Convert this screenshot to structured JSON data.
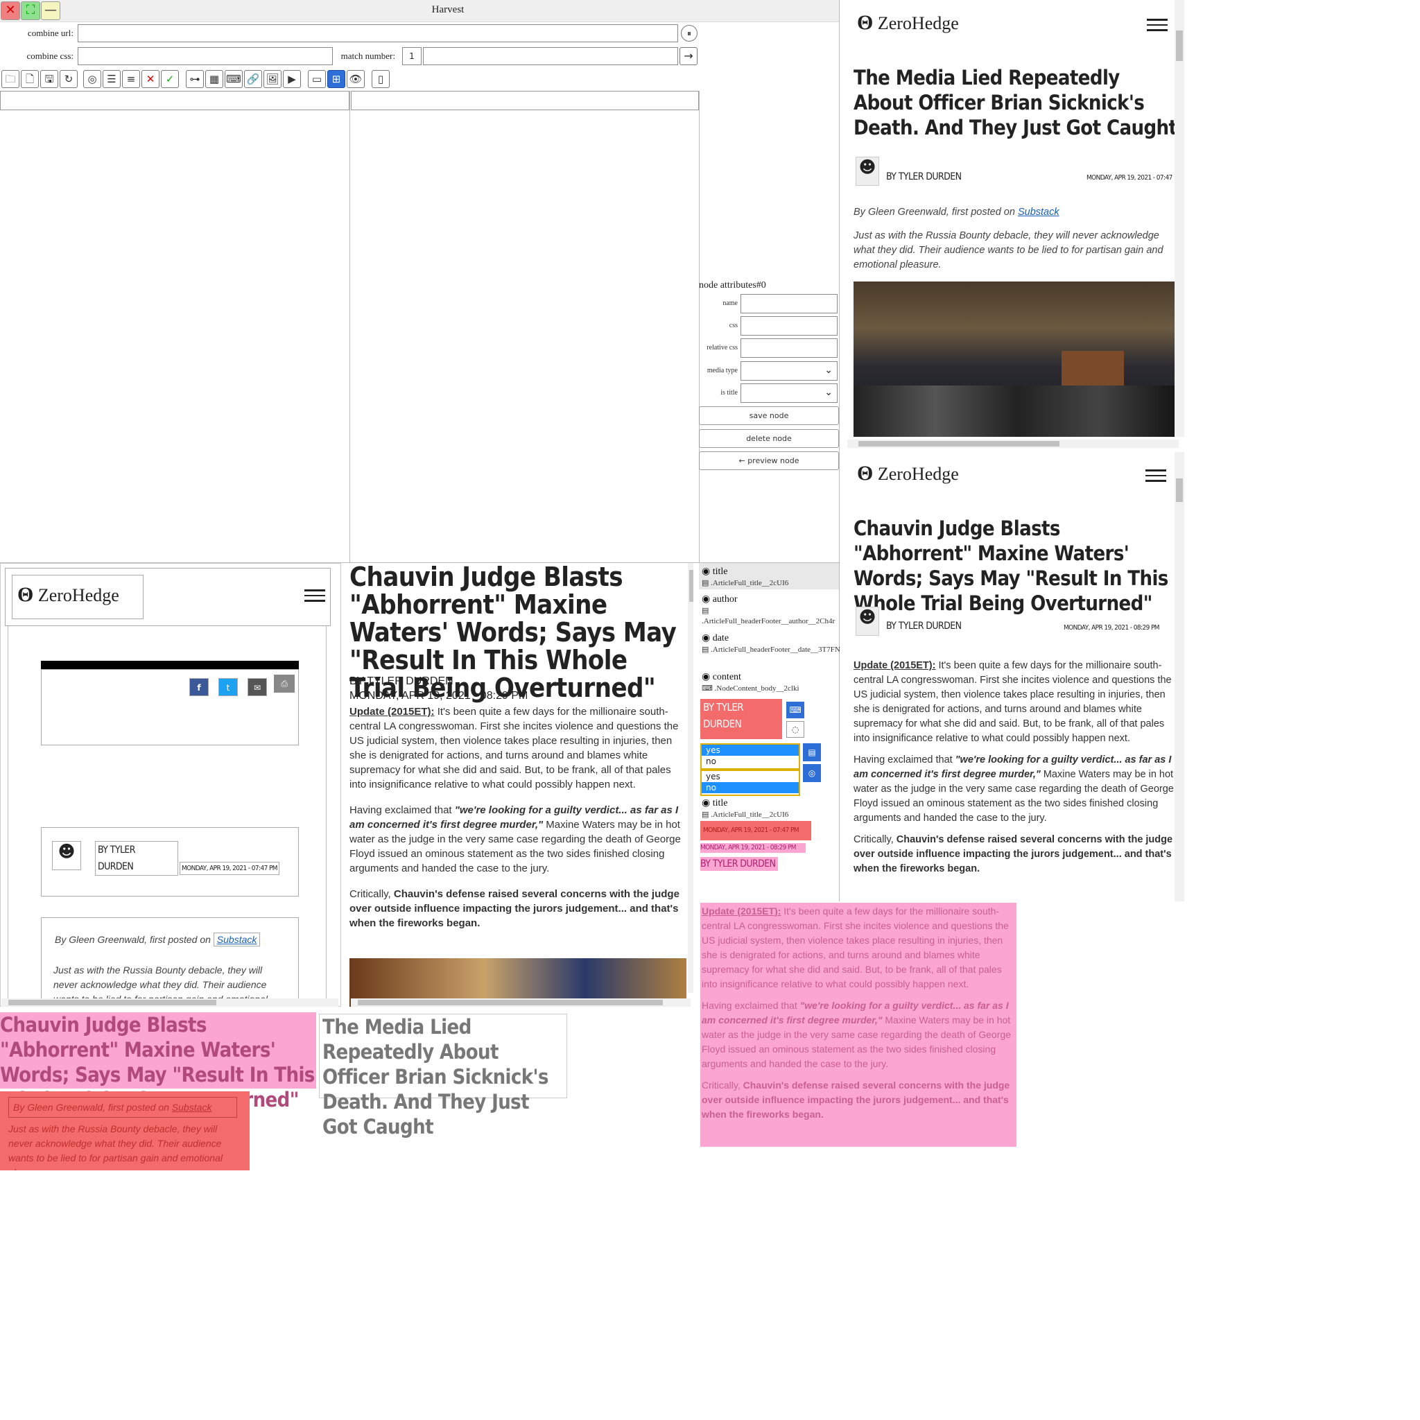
{
  "app": {
    "title": "Harvest"
  },
  "form": {
    "combine_url_label": "combine url:",
    "combine_css_label": "combine css:",
    "match_number_label": "match number:",
    "match_number_value": "1"
  },
  "attributes": {
    "heading": "node attributes#0",
    "name_label": "name",
    "css_label": "css",
    "relative_css_label": "relative css",
    "media_type_label": "media type",
    "is_title_label": "is title",
    "save_label": "save node",
    "delete_label": "delete node",
    "preview_label": "← preview node"
  },
  "nodes": [
    {
      "label": "title",
      "css": ".ArticleFull_title__2cUI6"
    },
    {
      "label": "author",
      "css": ".ArticleFull_headerFooter__author__2Ch4r"
    },
    {
      "label": "date",
      "css": ".ArticleFull_headerFooter__date__3T7FN"
    },
    {
      "label": "content",
      "css": ".NodeContent_body__2clki"
    }
  ],
  "node_tail": {
    "label": "title",
    "css": ".ArticleFull_title__2cUI6"
  },
  "options": {
    "yes": "yes",
    "no": "no"
  },
  "site": {
    "logo": "ZeroHedge"
  },
  "article1": {
    "title": "The Media Lied Repeatedly About Officer Brian Sicknick's Death. And They Just Got Caught",
    "author": "BY TYLER DURDEN",
    "author_short1": "BY TYLER",
    "author_short2": "DURDEN",
    "date": "MONDAY, APR 19, 2021 - 07:47",
    "date_pm": "MONDAY, APR 19, 2021 - 07:47 PM",
    "byline_pre": "By Gleen Greenwald, first posted on ",
    "byline_link": "Substack",
    "lead": "Just as with the Russia Bounty debacle, they will never acknowledge what they did. Their audience wants to be lied to for partisan gain and emotional pleasure."
  },
  "article2": {
    "title": "Chauvin Judge Blasts \"Abhorrent\" Maxine Waters' Words; Says May \"Result In This Whole Trial Being Overturned\"",
    "author": "BY TYLER DURDEN",
    "date": "MONDAY, APR 19, 2021 - 08:29 PM",
    "p1_label": "Update (2015ET):",
    "p1": " It's been quite a few days for the millionaire south-central LA congresswoman. First she incites violence and questions the US judicial system, then violence takes place resulting in injuries, then she is denigrated for actions, and turns around and blames white supremacy for what she did and said. But, to be frank, all of that pales into insignificance relative to what could possibly happen next.",
    "p2_pre": "Having exclaimed that ",
    "p2_quote": "\"we're looking for a guilty verdict... as far as I am concerned it's first degree murder,\"",
    "p2_post": " Maxine Waters may be in hot water as the judge in the very same case regarding the death of George Floyd issued an ominous statement as the two sides finished closing arguments and handed the case to the jury.",
    "p3_pre": "Critically, ",
    "p3_bold": "Chauvin's defense raised several concerns with the judge over outside influence impacting the jurors judgement... and that's when the fireworks began."
  },
  "media_title": "The Media Lied Repeatedly About Officer Brian Sicknick's Death. And They Just Got Caught",
  "colors": {
    "pink": "#fba5d3",
    "red": "#f46b6b",
    "accent": "#2d6fd6"
  }
}
